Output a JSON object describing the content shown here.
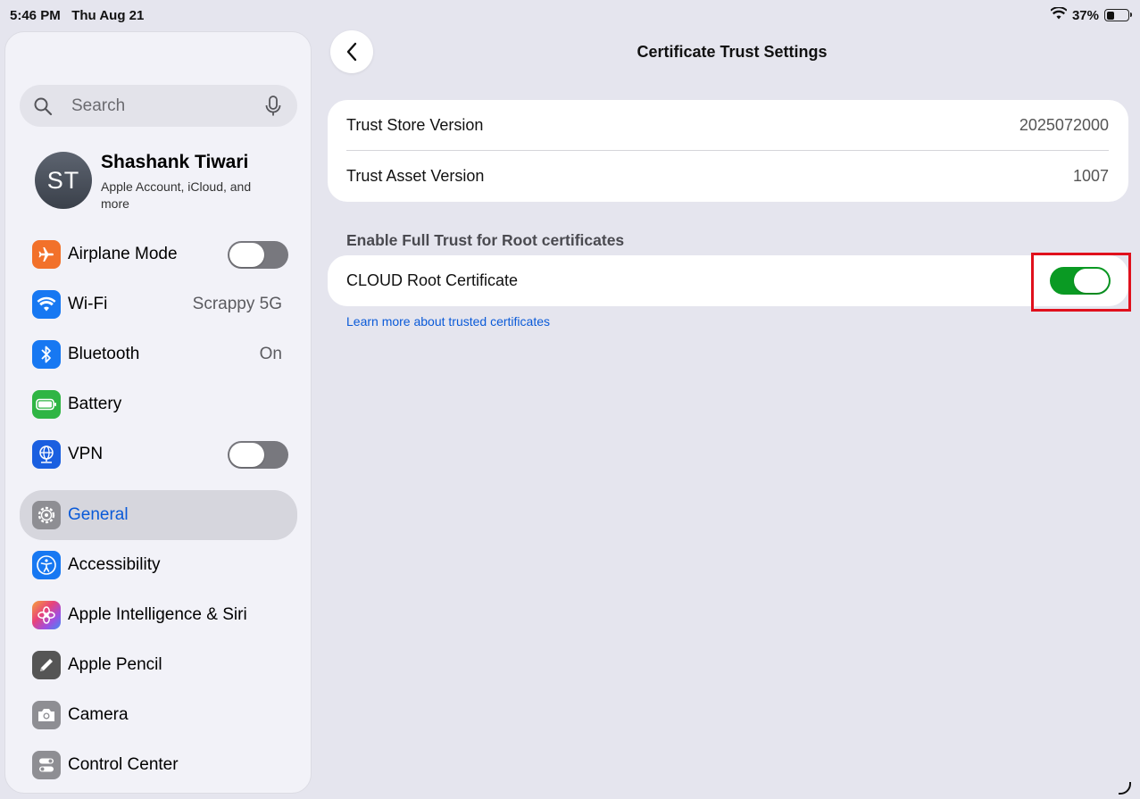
{
  "status_bar": {
    "time": "5:46 PM",
    "date": "Thu Aug 21",
    "battery_percent": "37%",
    "battery_level": 0.37
  },
  "sidebar": {
    "search_placeholder": "Search",
    "profile": {
      "initials": "ST",
      "name": "Shashank Tiwari",
      "subtitle": "Apple Account, iCloud, and more"
    },
    "items": [
      {
        "label": "Airplane Mode",
        "icon": "airplane-icon",
        "color": "#f2712a",
        "toggle": false
      },
      {
        "label": "Wi-Fi",
        "icon": "wifi-icon",
        "color": "#1778f2",
        "value": "Scrappy 5G"
      },
      {
        "label": "Bluetooth",
        "icon": "bluetooth-icon",
        "color": "#1778f2",
        "value": "On"
      },
      {
        "label": "Battery",
        "icon": "battery-icon",
        "color": "#2fb544"
      },
      {
        "label": "VPN",
        "icon": "globe-icon",
        "color": "#1a5fe0",
        "toggle": false
      },
      {
        "label": "General",
        "icon": "gear-icon",
        "color": "#8e8e93",
        "selected": true
      },
      {
        "label": "Accessibility",
        "icon": "accessibility-icon",
        "color": "#1778f2"
      },
      {
        "label": "Apple Intelligence & Siri",
        "icon": "siri-icon",
        "color": "#b14fd0"
      },
      {
        "label": "Apple Pencil",
        "icon": "pencil-icon",
        "color": "#555555"
      },
      {
        "label": "Camera",
        "icon": "camera-icon",
        "color": "#8e8e93"
      },
      {
        "label": "Control Center",
        "icon": "control-center-icon",
        "color": "#8e8e93"
      }
    ]
  },
  "main": {
    "title": "Certificate Trust Settings",
    "versions": [
      {
        "label": "Trust Store Version",
        "value": "2025072000"
      },
      {
        "label": "Trust Asset Version",
        "value": "1007"
      }
    ],
    "section_header": "Enable Full Trust for Root certificates",
    "certificate": {
      "label": "CLOUD Root Certificate",
      "enabled": true
    },
    "learn_more": "Learn more about trusted certificates"
  },
  "colors": {
    "accent": "#0a5ad8",
    "toggle_on": "#0a9a23",
    "highlight": "#e0101c"
  }
}
